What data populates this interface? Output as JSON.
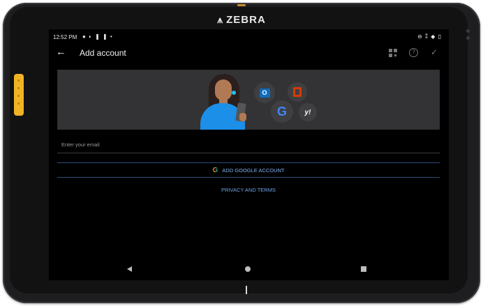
{
  "device": {
    "brand": "ZEBRA"
  },
  "status_bar": {
    "time": "12:52 PM",
    "notifications": "● ◐ ❚ ❚ •",
    "system_icons": "⊖ ⁑ ◆ ▯"
  },
  "app_bar": {
    "back": "←",
    "title": "Add account",
    "help": "?",
    "confirm": "✓"
  },
  "banner": {
    "services": [
      "outlook-icon",
      "office-icon",
      "google-icon",
      "yahoo-icon"
    ],
    "outlook_glyph": "O",
    "google_glyph": "G",
    "yahoo_glyph": "y!"
  },
  "email_field": {
    "placeholder": "Enter your email"
  },
  "google_button": {
    "icon": "G",
    "label": "ADD GOOGLE ACCOUNT"
  },
  "privacy_link": {
    "label": "PRIVACY AND TERMS"
  },
  "colors": {
    "accent": "#7fb2f0",
    "side_key": "#f0b323"
  }
}
